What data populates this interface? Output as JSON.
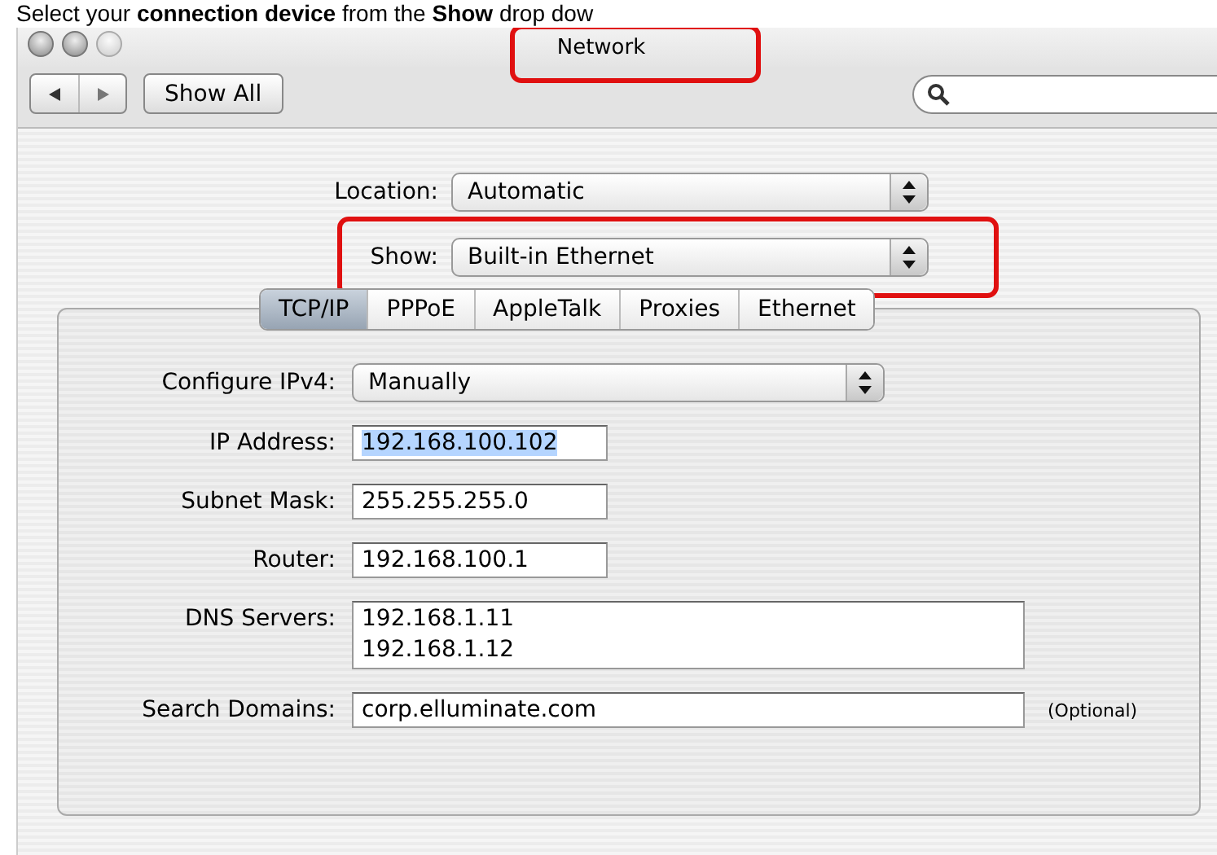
{
  "caption": "Select your **connection device** from the **Show** drop dow",
  "window": {
    "title": "Network",
    "title_highlighted": true
  },
  "toolbar": {
    "show_all": "Show All"
  },
  "location": {
    "label": "Location:",
    "value": "Automatic"
  },
  "show": {
    "label": "Show:",
    "value": "Built-in Ethernet",
    "highlighted": true
  },
  "tabs": [
    {
      "label": "TCP/IP",
      "selected": true
    },
    {
      "label": "PPPoE",
      "selected": false
    },
    {
      "label": "AppleTalk",
      "selected": false
    },
    {
      "label": "Proxies",
      "selected": false
    },
    {
      "label": "Ethernet",
      "selected": false
    }
  ],
  "fields": [
    {
      "kind": "popup",
      "label": "Configure IPv4:",
      "values": [
        "Manually"
      ]
    },
    {
      "kind": "field",
      "label": "IP Address:",
      "values": [
        "192.168.100.102"
      ],
      "text_selected": true
    },
    {
      "kind": "field",
      "label": "Subnet Mask:",
      "values": [
        "255.255.255.0"
      ],
      "text_selected": false
    },
    {
      "kind": "field",
      "label": "Router:",
      "values": [
        "192.168.100.1"
      ],
      "text_selected": false
    },
    {
      "kind": "multiline",
      "label": "DNS Servers:",
      "values": [
        "192.168.1.11",
        "192.168.1.12"
      ]
    },
    {
      "kind": "wide",
      "label": "Search Domains:",
      "values": [
        "corp.elluminate.com"
      ],
      "note": "(Optional)"
    }
  ]
}
